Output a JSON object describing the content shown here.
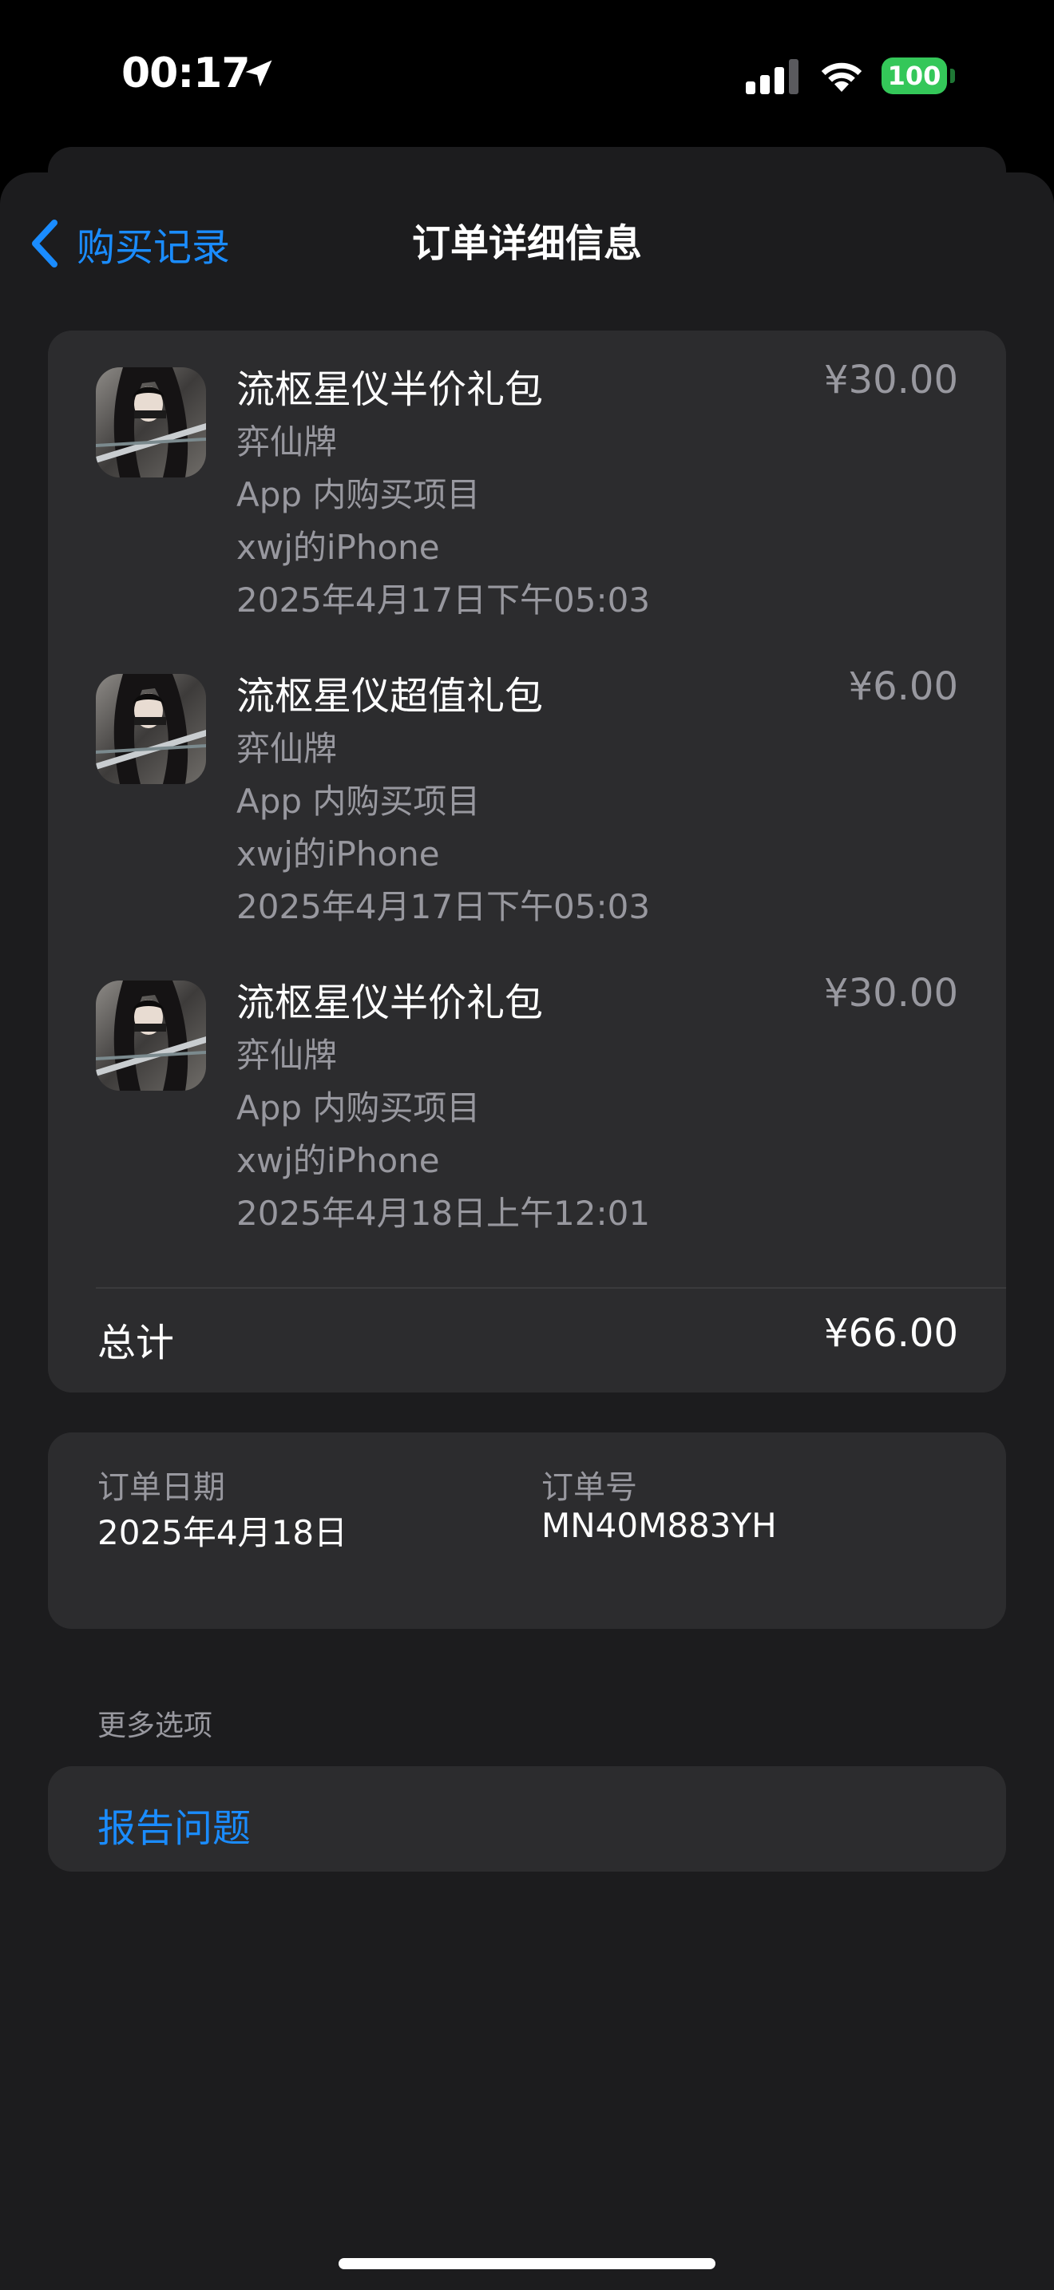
{
  "status_bar": {
    "time": "00:17",
    "battery": "100",
    "battery_color": "#34c759"
  },
  "nav": {
    "back_label": "购买记录",
    "title": "订单详细信息",
    "accent_color": "#1a8cff"
  },
  "items": [
    {
      "title": "流枢星仪半价礼包",
      "price": "¥30.00",
      "developer": "弈仙牌",
      "type": "App 内购买项目",
      "device": "xwj的iPhone",
      "datetime": "2025年4月17日下午05:03",
      "icon": "game-app-icon"
    },
    {
      "title": "流枢星仪超值礼包",
      "price": "¥6.00",
      "developer": "弈仙牌",
      "type": "App 内购买项目",
      "device": "xwj的iPhone",
      "datetime": "2025年4月17日下午05:03",
      "icon": "game-app-icon"
    },
    {
      "title": "流枢星仪半价礼包",
      "price": "¥30.00",
      "developer": "弈仙牌",
      "type": "App 内购买项目",
      "device": "xwj的iPhone",
      "datetime": "2025年4月18日上午12:01",
      "icon": "game-app-icon"
    }
  ],
  "total": {
    "label": "总计",
    "value": "¥66.00"
  },
  "order": {
    "date_label": "订单日期",
    "date_value": "2025年4月18日",
    "number_label": "订单号",
    "number_value": "MN40M883YH"
  },
  "more_options": {
    "section_label": "更多选项",
    "report_label": "报告问题"
  }
}
